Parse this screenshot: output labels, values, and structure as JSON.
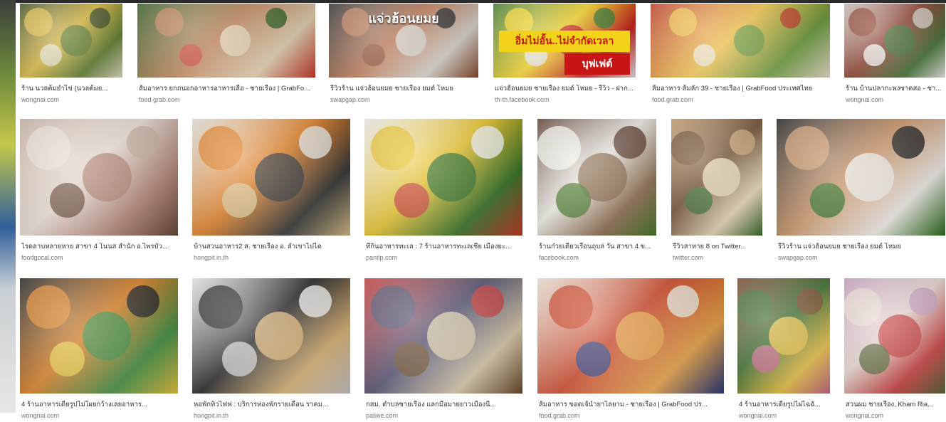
{
  "results": [
    {
      "title": "ร้าน นวลต้มยำไข่ (นวลต้มย...",
      "source": "wongnai.com",
      "palette": [
        "#3a4a1e",
        "#d8b63a",
        "#5a7a2a",
        "#e8e0c8"
      ]
    },
    {
      "title": "ส้มอาหาร ยกถนอกอาหารอาหารเลือ - ชายเรือง | GrabFood ...",
      "source": "food.grab.com",
      "palette": [
        "#2d5a1c",
        "#b8784a",
        "#e4d2b0",
        "#c93a2a"
      ]
    },
    {
      "title": "รีวิวร้าน แจ่วฮ้อนยมย ชายเรือง ยมต์ โหมย",
      "source": "swapgap.com",
      "palette": [
        "#2a2a2a",
        "#b9724d",
        "#d9d5cc",
        "#8a4a2e"
      ],
      "overlay": "แจ่วฮ้อนยมย"
    },
    {
      "title": "แจ่วฮ้อนยมย ชายเรือง ยมต์ โหมย - รีวิว - ฝาก...",
      "source": "th-th.facebook.com",
      "palette": [
        "#3a7a2a",
        "#f3d21a",
        "#c81616",
        "#e8e8e8"
      ],
      "banner": "อิ่มไม่อั้น..ไม่จำกัดเวลา",
      "banner2": "บุฟเฟต์"
    },
    {
      "title": "ส้มอาหาร ส้มลัก 39 - ชายเรือง | GrabFood ประเทศไทย",
      "source": "food.grab.com",
      "palette": [
        "#c23a22",
        "#f0c040",
        "#6a9a3a",
        "#efe4d0"
      ]
    },
    {
      "title": "ร้าน บ้านปลากะพงซาคสอ - ชา...",
      "source": "wongnai.com",
      "palette": [
        "#d0c8be",
        "#8a3a2a",
        "#3a6a2a",
        "#f2f0ec"
      ]
    },
    {
      "title": "ไรดลาบหลายหาย สาขา 4 โนนส สำนัก อ.ไพรบัว...",
      "source": "foodgocal.com",
      "palette": [
        "#c8b0a0",
        "#e8dcd2",
        "#b08070",
        "#6a4a3a"
      ]
    },
    {
      "title": "บ้านสวนอาหาร2 ส. ชายเรือง อ. ลำเขาไปได",
      "source": "hongpit.in.th",
      "palette": [
        "#e6e4de",
        "#e07a1a",
        "#2a2a2a",
        "#d9c08a"
      ]
    },
    {
      "title": "ที่กินอาหารทะเล : 7 ร้านอาหารทะเลเชีย เมืองยะ...",
      "source": "pantip.com",
      "palette": [
        "#f2f2ef",
        "#e8c020",
        "#2a6a1a",
        "#c83a2a"
      ]
    },
    {
      "title": "ร้านก๋วยเตี๋ยวเรือนถุบล่ วัน สาขา 4 ข...",
      "source": "facebook.com",
      "palette": [
        "#5a3a2a",
        "#f0eee8",
        "#8a6a4a",
        "#4a7a2a"
      ]
    },
    {
      "title": "รีวิวสาหาย 8 on Twitter...",
      "source": "twitter.com",
      "palette": [
        "#c8a070",
        "#6a4a2a",
        "#e8d8b8",
        "#3a6a2a"
      ]
    },
    {
      "title": "รีวิวร้าน แจ่วฮ้อนยมย ชายเรือง ยมต์ โหมย",
      "source": "swapgap.com",
      "palette": [
        "#1a1a1a",
        "#c89060",
        "#f0ece6",
        "#2a6a1a"
      ]
    },
    {
      "title": "4 ร้านอาหารเดียรูปไม่ใผยกว้างเลยอาหาร...",
      "source": "wongnai.com",
      "palette": [
        "#1a1a1a",
        "#d87a1a",
        "#3a8a3a",
        "#e8c840"
      ]
    },
    {
      "title": "หอพักทิวไฟฟ : บริการห่องพักรายเดือน ราคม...",
      "source": "hongpit.in.th",
      "palette": [
        "#f0f0ee",
        "#1a1a1a",
        "#d8b070",
        "#c8c8c8"
      ]
    },
    {
      "title": "กสม. ตำบลชายเรือง แลกมือมายยาวเมืองนี้...",
      "source": "paliwe.com",
      "palette": [
        "#c83a3a",
        "#4a4a6a",
        "#d8c8a8",
        "#6a4a2a"
      ]
    },
    {
      "title": "ส้มอาหาร ขอดเจ้น้ำยาไลยาม - ชายเรือง | GrabFood ปร...",
      "source": "food.grab.com",
      "palette": [
        "#efe9dc",
        "#c83a1a",
        "#e8a040",
        "#2a3a7a"
      ]
    },
    {
      "title": "4 ร้านอาหารเดียรูปไผ่ไฉฉั...",
      "source": "wongnai.com",
      "palette": [
        "#7a4a2a",
        "#3a6a2a",
        "#e8c040",
        "#c86a8a"
      ]
    },
    {
      "title": "สวนผม ชายเรือง, Kham Ria...",
      "source": "wongnai.com",
      "palette": [
        "#c8a0c0",
        "#e8d8d0",
        "#c83a3a",
        "#5a6a3a"
      ]
    }
  ]
}
